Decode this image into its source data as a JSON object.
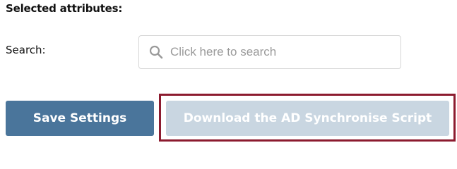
{
  "selected_attributes": {
    "heading": "Selected attributes:"
  },
  "search": {
    "label": "Search:",
    "value": "",
    "placeholder": "Click here to search",
    "icon": "search-icon"
  },
  "actions": {
    "save_label": "Save Settings",
    "download_label": "Download the AD Synchronise Script",
    "download_disabled": true
  },
  "colors": {
    "save_button": "#4a759b",
    "download_button_disabled": "#c9d6e1",
    "highlight_frame": "#8c1b2f"
  }
}
